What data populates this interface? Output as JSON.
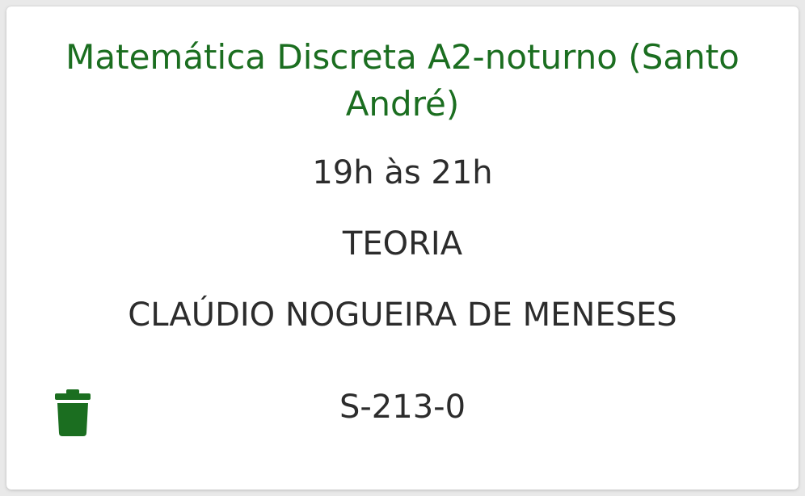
{
  "card": {
    "title": "Matemática Discreta A2-noturno (Santo André)",
    "time": "19h às 21h",
    "type": "TEORIA",
    "teacher": "CLAÚDIO NOGUEIRA DE MENESES",
    "room": "S-213-0",
    "delete_icon": "trash-icon"
  },
  "colors": {
    "accent": "#1b6e20",
    "text": "#2c2c2c",
    "card_background": "#ffffff"
  }
}
